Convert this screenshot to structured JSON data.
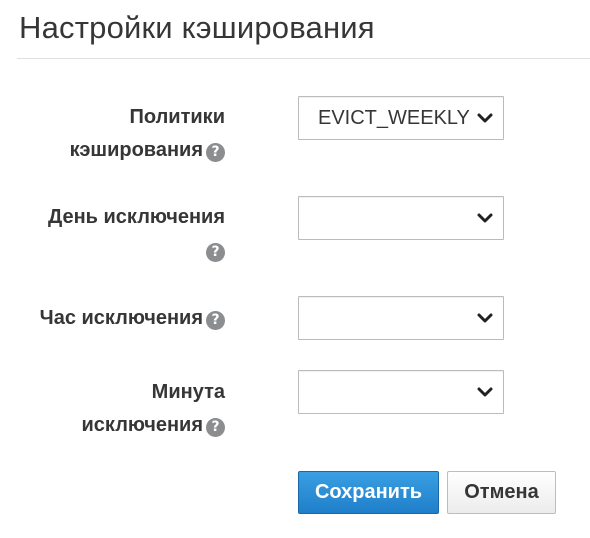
{
  "page": {
    "title": "Настройки кэширования"
  },
  "form": {
    "fields": [
      {
        "label_line1": "Политики",
        "label_line2": "кэширования",
        "value": "EVICT_WEEKLY",
        "help_icon": "question-circle-icon"
      },
      {
        "label_line1": "День исключения",
        "label_line2": "",
        "value": "",
        "help_icon": "question-circle-icon"
      },
      {
        "label_line1": "Час исключения",
        "label_line2": "",
        "value": "",
        "help_icon": "question-circle-icon"
      },
      {
        "label_line1": "Минута",
        "label_line2": "исключения",
        "value": "",
        "help_icon": "question-circle-icon"
      }
    ],
    "help_glyph": "?",
    "save_label": "Сохранить",
    "cancel_label": "Отмена"
  },
  "colors": {
    "primary_button": "#2a8bd5",
    "text": "#363636",
    "help_icon": "#8b8d8f"
  }
}
